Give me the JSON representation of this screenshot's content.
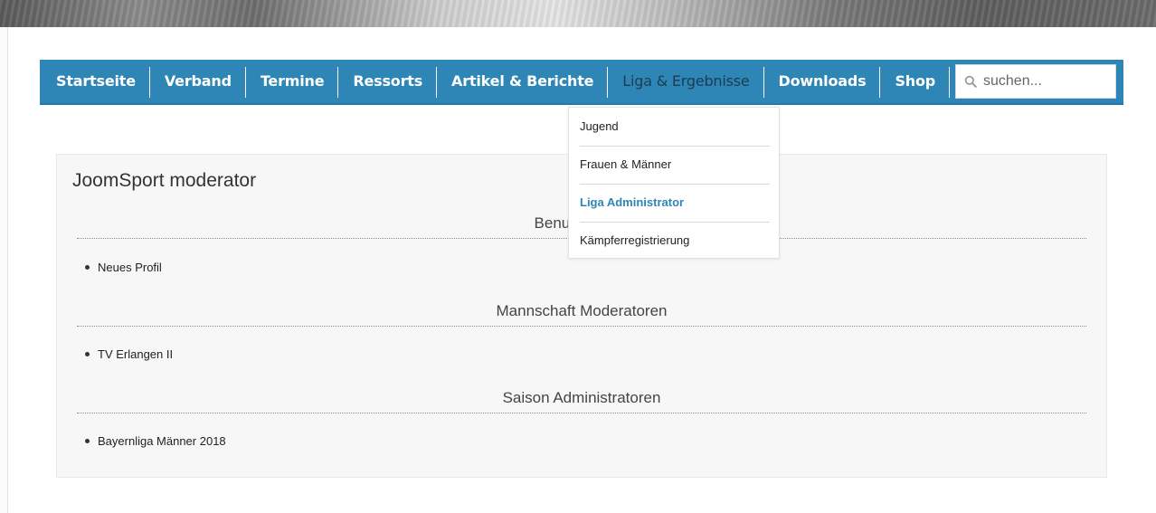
{
  "nav": {
    "items": [
      {
        "label": "Startseite"
      },
      {
        "label": "Verband"
      },
      {
        "label": "Termine"
      },
      {
        "label": "Ressorts"
      },
      {
        "label": "Artikel & Berichte"
      },
      {
        "label": "Liga & Ergebnisse"
      },
      {
        "label": "Downloads"
      },
      {
        "label": "Shop"
      }
    ],
    "active_index": 5
  },
  "search": {
    "placeholder": "suchen...",
    "value": ""
  },
  "dropdown": {
    "items": [
      {
        "label": "Jugend"
      },
      {
        "label": "Frauen & Männer"
      },
      {
        "label": "Liga Administrator",
        "active": true
      },
      {
        "label": "Kämpferregistrierung"
      }
    ]
  },
  "panel": {
    "title": "JoomSport moderator",
    "sections": [
      {
        "heading": "Benutzerprofil",
        "items": [
          "Neues Profil"
        ]
      },
      {
        "heading": "Mannschaft Moderatoren",
        "items": [
          "TV Erlangen II"
        ]
      },
      {
        "heading": "Saison Administratoren",
        "items": [
          "Bayernliga Männer 2018"
        ]
      }
    ]
  },
  "colors": {
    "nav_bg": "#2e86b6",
    "active_link": "#2e86b6",
    "panel_bg": "#f7f7f7"
  },
  "icons": {
    "search": "search-icon"
  }
}
